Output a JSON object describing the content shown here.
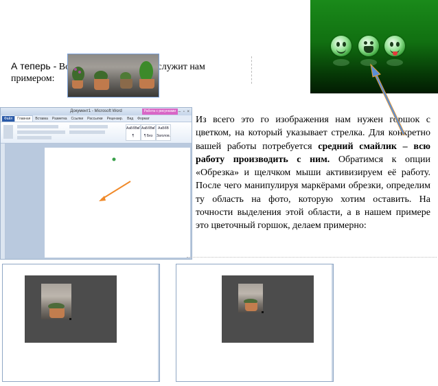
{
  "intro": {
    "lead": "А теперь  -",
    "rest": " Вот это   изображение послужит нам примером:"
  },
  "body": {
    "p1": "Из всего это го изображения нам нужен горшок с цветком, на который указывает стрелка.       Для конкретно вашей работы потребуется ",
    "bold": "средний смайлик – всю работу производить с ним.",
    "p2": " Обратимся к опции «Обрезка» и щелчком мыши активизируем её работу. После чего манипулируя маркёрами обрезки, определим ту область       на фото, которую хотим оставить. На точности выделения этой области, а в нашем примере это цветочный горшок, делаем примерно:"
  },
  "word_window": {
    "title": "Документ1 - Microsoft Word",
    "context_tab": "Работа с рисунками",
    "tabs": [
      "Файл",
      "Главная",
      "Вставка",
      "Разметка",
      "Ссылки",
      "Рассылки",
      "Рецензир.",
      "Вид",
      "Формат"
    ],
    "active_tab_index": 1,
    "styles": [
      "АаБбВвГ",
      "АаБбВвГ",
      "АаБбВ"
    ],
    "style_names": [
      "¶ Обычный",
      "¶ Без инте...",
      "Заголов..."
    ]
  },
  "colors": {
    "accent_arrow": "#5b8fd6",
    "photo_arrow": "#f08a2a",
    "green_bg": "#117011"
  }
}
